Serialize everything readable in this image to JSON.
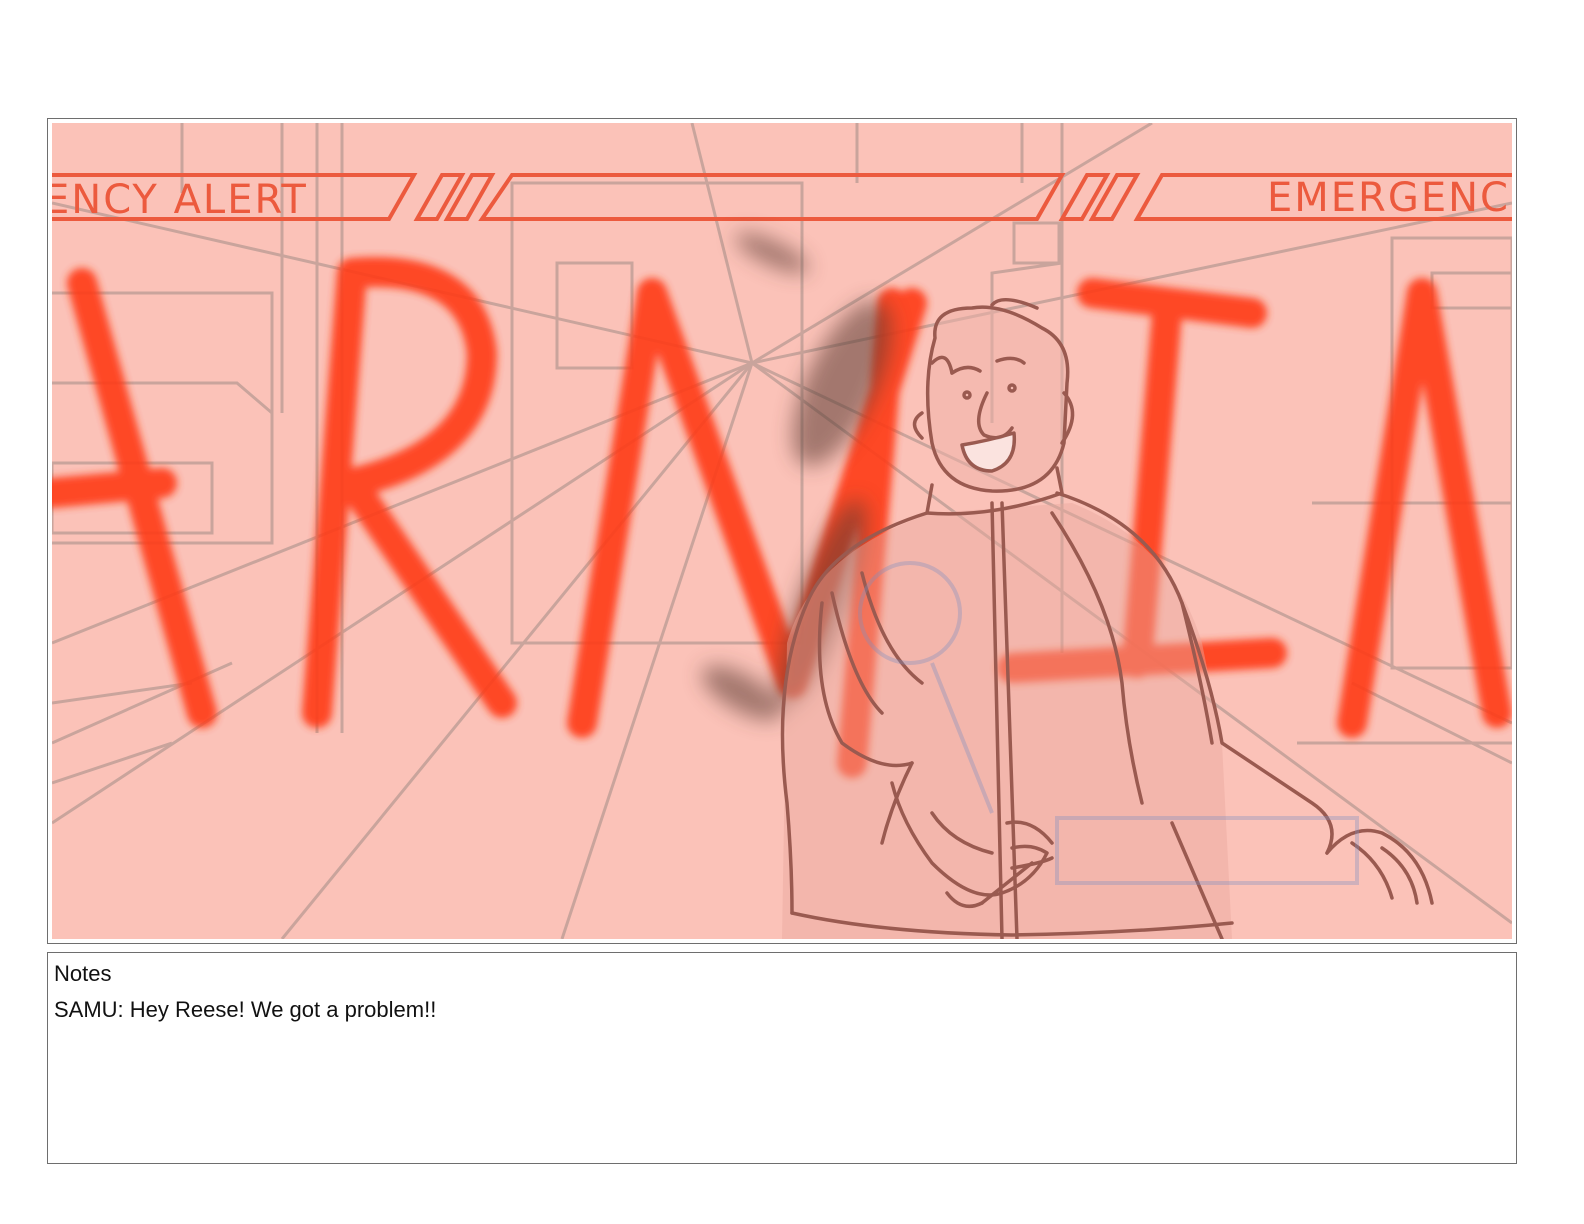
{
  "panel": {
    "banner_left": "ENCY ALERT",
    "banner_right": "EMERGENC",
    "warning_word": "WARNING",
    "colors": {
      "background": "#fbc2b8",
      "banner": "#ec5a3e",
      "big_letters": "#ff3a14",
      "sketch_lines": "#a88078",
      "character_lines": "#9a5a50"
    }
  },
  "notes": {
    "label": "Notes",
    "text": "SAMU: Hey Reese! We got a problem!!"
  }
}
